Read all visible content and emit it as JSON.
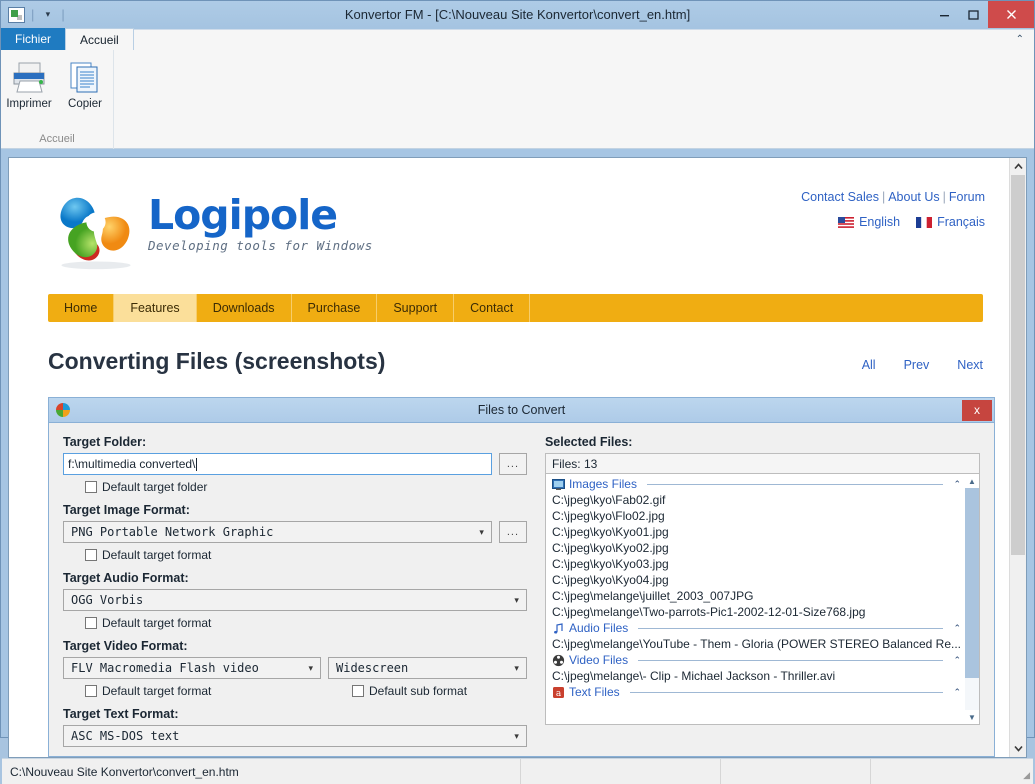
{
  "window": {
    "title": "Konvertor FM - [C:\\Nouveau Site Konvertor\\convert_en.htm]",
    "quick_access": {
      "icon": "app-icon",
      "dropdown": "▾"
    },
    "minimize": "–",
    "maximize": "□",
    "close": "✕"
  },
  "ribbon": {
    "tabs": [
      {
        "label": "Fichier",
        "active": false,
        "kind": "file"
      },
      {
        "label": "Accueil",
        "active": true,
        "kind": "normal"
      }
    ],
    "collapse_icon": "⌃",
    "group": {
      "label": "Accueil",
      "items": [
        {
          "label": "Imprimer",
          "icon": "printer-icon"
        },
        {
          "label": "Copier",
          "icon": "copy-icon"
        }
      ]
    }
  },
  "page": {
    "logo": {
      "word": "Logipole",
      "tagline": "Developing tools for Windows"
    },
    "toplinks": [
      {
        "label": "Contact Sales"
      },
      {
        "label": "About Us"
      },
      {
        "label": "Forum"
      }
    ],
    "toplinks_separator": "|",
    "languages": [
      {
        "label": "English",
        "flag": "us-flag-icon"
      },
      {
        "label": "Français",
        "flag": "fr-flag-icon"
      }
    ],
    "nav": [
      {
        "label": "Home",
        "active": false
      },
      {
        "label": "Features",
        "active": true
      },
      {
        "label": "Downloads",
        "active": false
      },
      {
        "label": "Purchase",
        "active": false
      },
      {
        "label": "Support",
        "active": false
      },
      {
        "label": "Contact",
        "active": false
      }
    ],
    "title": "Converting Files (screenshots)",
    "pager": [
      {
        "label": "All"
      },
      {
        "label": "Prev"
      },
      {
        "label": "Next"
      }
    ]
  },
  "dialog": {
    "title": "Files to Convert",
    "close_label": "x",
    "target_folder": {
      "label": "Target Folder:",
      "value": "f:\\multimedia converted\\",
      "browse_label": "...",
      "checkbox": {
        "label": "Default target folder",
        "checked": false
      }
    },
    "target_image_format": {
      "label": "Target Image Format:",
      "value": "PNG   Portable Network Graphic",
      "browse_label": "...",
      "checkbox": {
        "label": "Default target format",
        "checked": false
      }
    },
    "target_audio_format": {
      "label": "Target Audio Format:",
      "value": "OGG   Vorbis",
      "checkbox": {
        "label": "Default target format",
        "checked": false
      }
    },
    "target_video_format": {
      "label": "Target Video Format:",
      "value": "FLV   Macromedia Flash video",
      "sub_value": "Widescreen",
      "checkbox": {
        "label": "Default target format",
        "checked": false
      },
      "sub_checkbox": {
        "label": "Default sub format",
        "checked": false
      }
    },
    "target_text_format": {
      "label": "Target Text Format:",
      "value": "ASC   MS-DOS text"
    },
    "selected_files": {
      "label": "Selected Files:",
      "count_text": "Files: 13",
      "collapse_icon": "⌃",
      "groups": [
        {
          "name": "Images Files",
          "icon": "image-files-icon",
          "files": [
            "C:\\jpeg\\kyo\\Fab02.gif",
            "C:\\jpeg\\kyo\\Flo02.jpg",
            "C:\\jpeg\\kyo\\Kyo01.jpg",
            "C:\\jpeg\\kyo\\Kyo02.jpg",
            "C:\\jpeg\\kyo\\Kyo03.jpg",
            "C:\\jpeg\\kyo\\Kyo04.jpg",
            "C:\\jpeg\\melange\\juillet_2003_007JPG",
            "C:\\jpeg\\melange\\Two-parrots-Pic1-2002-12-01-Size768.jpg"
          ]
        },
        {
          "name": "Audio Files",
          "icon": "audio-files-icon",
          "files": [
            "C:\\jpeg\\melange\\YouTube - Them - Gloria (POWER STEREO Balanced Re..."
          ]
        },
        {
          "name": "Video Files",
          "icon": "video-files-icon",
          "files": [
            "C:\\jpeg\\melange\\- Clip - Michael Jackson - Thriller.avi"
          ]
        },
        {
          "name": "Text Files",
          "icon": "text-files-icon",
          "files": []
        }
      ]
    }
  },
  "statusbar": {
    "path": "C:\\Nouveau Site Konvertor\\convert_en.htm",
    "pane2": "",
    "pane3": "",
    "grip": "◢"
  },
  "colors": {
    "titlebar": "#a5c4e1",
    "file_tab": "#1f7bc1",
    "close_button": "#cf4b4b",
    "nav_bar": "#f0ad12",
    "nav_active": "#fbdf9a",
    "link_blue": "#2f62c4",
    "logo_blue": "#1565c8"
  }
}
